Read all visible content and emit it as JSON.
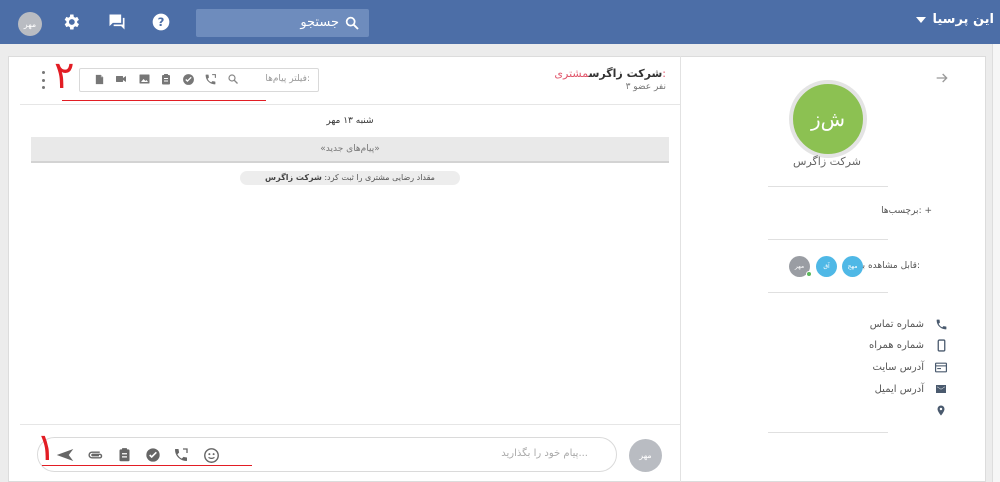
{
  "topbar": {
    "brand": "این پرسیا",
    "search_label": "جستجو",
    "user_avatar": "مهر"
  },
  "profile": {
    "initials": "ش‌ز",
    "name": "شرکت زاگرس",
    "tags_label": "برچسب‌ها: +",
    "visible_label": "قابل مشاهده برای:",
    "avatars": [
      {
        "text": "مهج",
        "color": "#4fb8e6"
      },
      {
        "text": "آق",
        "color": "#4fb8e6"
      },
      {
        "text": "مهر",
        "color": "#9a9da3"
      }
    ],
    "contacts": [
      {
        "label": "شماره تماس",
        "icon": "phone-icon"
      },
      {
        "label": "شماره همراه",
        "icon": "mobile-icon"
      },
      {
        "label": "آدرس سایت",
        "icon": "web-icon"
      },
      {
        "label": "آدرس ایمیل",
        "icon": "email-icon"
      }
    ]
  },
  "chat": {
    "customer_prefix": "مشتری:",
    "title": "شرکت زاگرس",
    "members": "۳ نفر عضو",
    "filter_placeholder": "فیلتر پیام‌ها:",
    "date": "شنبه ۱۳ مهر",
    "new_messages": "«پیام‌های جدید»",
    "system_message_prefix": "مقداد رضایی مشتری را ثبت کرد:",
    "system_message_name": "شرکت زاگرس"
  },
  "composer": {
    "placeholder": "پیام خود را بگذارید...",
    "avatar": "مهر"
  },
  "annotations": {
    "one": "۱",
    "two": "۲"
  },
  "colors": {
    "topbar": "#4c6ea7",
    "profile_green": "#8cc152",
    "annotation_red": "#e21d24"
  }
}
